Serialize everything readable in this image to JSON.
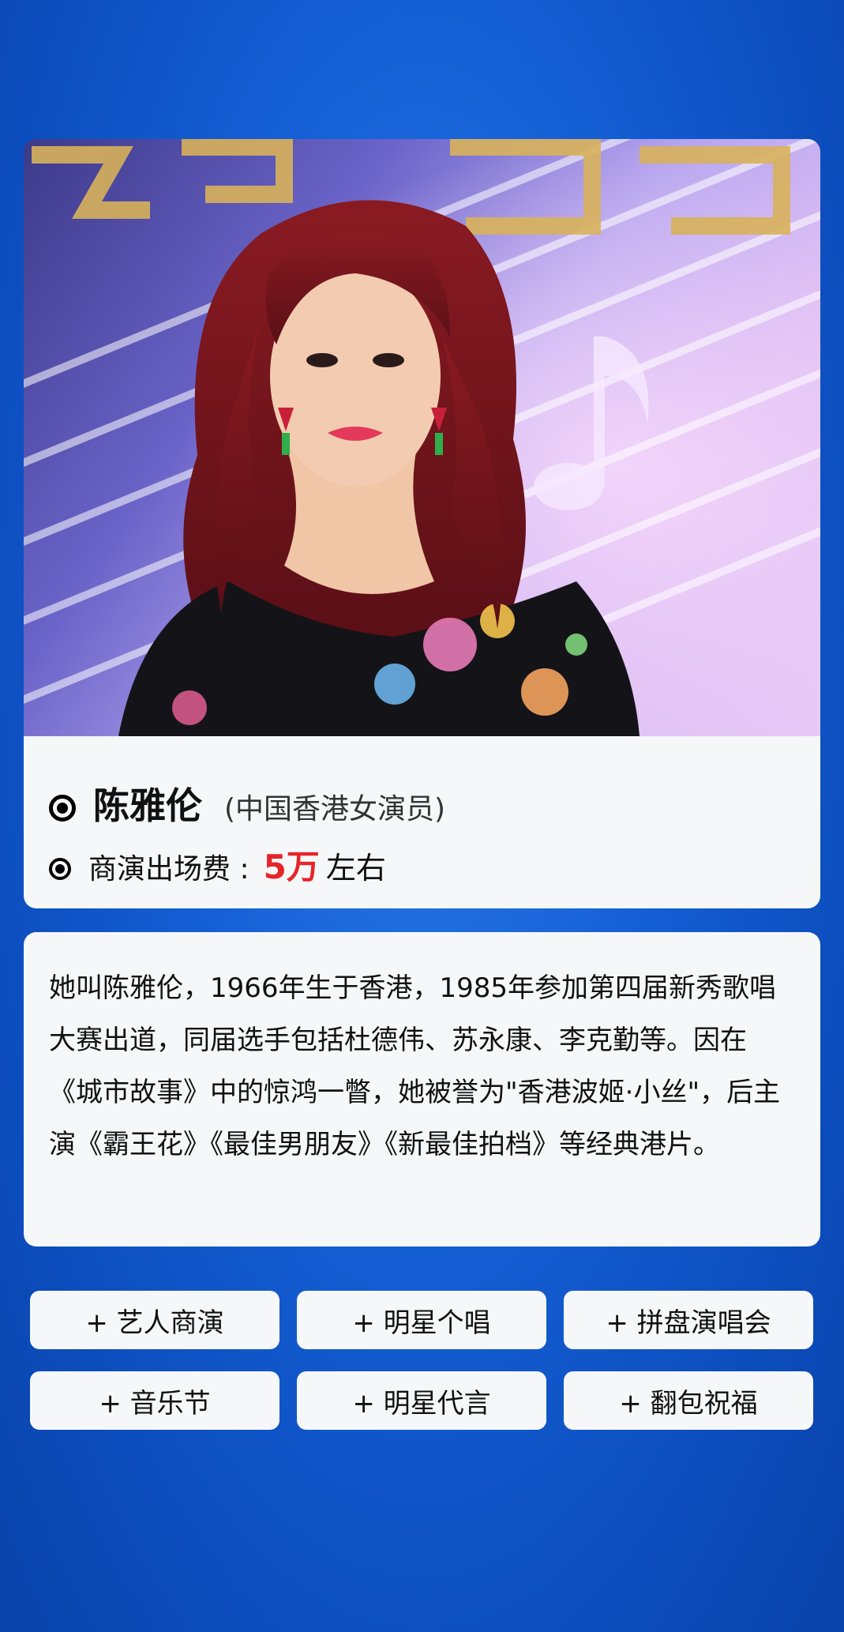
{
  "header": {
    "blurred_title": ""
  },
  "photo": {
    "subject": "portrait-photo"
  },
  "profile": {
    "name": "陈雅伦",
    "role": "(中国香港女演员)",
    "fee_label": "商演出场费 :",
    "fee_value": "5万",
    "fee_suffix": "左右"
  },
  "bio": {
    "text": "她叫陈雅伦，1966年生于香港，1985年参加第四届新秀歌唱大赛出道，同届选手包括杜德伟、苏永康、李克勤等。因在《城市故事》中的惊鸿一瞥，她被誉为\"香港波姬·小丝\"，后主演《霸王花》《最佳男朋友》《新最佳拍档》等经典港片。"
  },
  "tags": [
    {
      "label": "+ 艺人商演"
    },
    {
      "label": "+ 明星个唱"
    },
    {
      "label": "+ 拼盘演唱会"
    },
    {
      "label": "+ 音乐节"
    },
    {
      "label": "+ 明星代言"
    },
    {
      "label": "+ 翻包祝福"
    }
  ],
  "colors": {
    "background": "#1560d6",
    "card": "#f6f7f9",
    "fee_highlight": "#e6252a"
  }
}
